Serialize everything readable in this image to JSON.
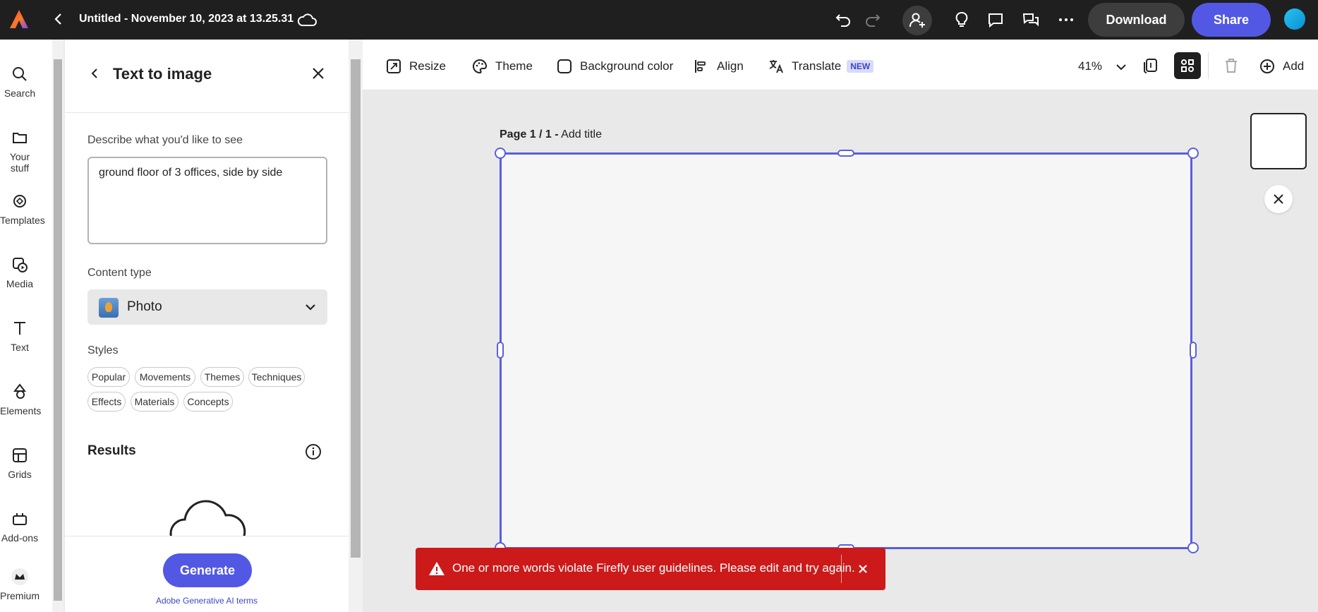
{
  "topbar": {
    "document_title": "Untitled - November 10, 2023 at 13.25.31",
    "download_label": "Download",
    "share_label": "Share"
  },
  "rail": {
    "items": [
      {
        "label": "Search",
        "icon": "search-icon"
      },
      {
        "label": "Your stuff",
        "icon": "folder-icon"
      },
      {
        "label": "Templates",
        "icon": "templates-icon"
      },
      {
        "label": "Media",
        "icon": "media-icon"
      },
      {
        "label": "Text",
        "icon": "text-icon"
      },
      {
        "label": "Elements",
        "icon": "elements-icon"
      },
      {
        "label": "Grids",
        "icon": "grids-icon"
      },
      {
        "label": "Add-ons",
        "icon": "addons-icon"
      },
      {
        "label": "Premium",
        "icon": "premium-icon"
      }
    ]
  },
  "panel": {
    "title": "Text to image",
    "prompt_label": "Describe what you'd like to see",
    "prompt_value": "ground floor of 3 offices, side by side",
    "content_type_label": "Content type",
    "content_type_value": "Photo",
    "styles_label": "Styles",
    "style_chips": [
      "Popular",
      "Movements",
      "Themes",
      "Techniques",
      "Effects",
      "Materials",
      "Concepts"
    ],
    "results_label": "Results",
    "generate_label": "Generate",
    "terms_link": "Adobe Generative AI terms"
  },
  "canvas_toolbar": {
    "resize": "Resize",
    "theme": "Theme",
    "background_color": "Background color",
    "align": "Align",
    "translate": "Translate",
    "translate_badge": "NEW",
    "zoom": "41%",
    "add": "Add"
  },
  "canvas": {
    "page_label_prefix": "Page 1 / 1 -",
    "page_title_placeholder": "Add title"
  },
  "toast": {
    "message": "One or more words violate Firefly user guidelines. Please edit and try again."
  },
  "colors": {
    "accent": "#5258e4",
    "topbar_bg": "#1f1f1f",
    "error_bg": "#cc1a1a",
    "selection": "#5a5fdc"
  }
}
